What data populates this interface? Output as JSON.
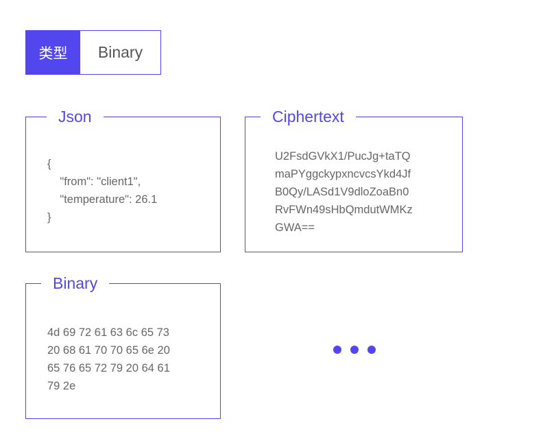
{
  "type_selector": {
    "label": "类型",
    "value": "Binary"
  },
  "panels": {
    "json": {
      "title": "Json",
      "content": "{\n    \"from\": \"client1\",\n    \"temperature\": 26.1\n}"
    },
    "ciphertext": {
      "title": "Ciphertext",
      "content": "U2FsdGVkX1/PucJg+taTQ\nmaPYggckypxncvcsYkd4Jf\nB0Qy/LASd1V9dloZoaBn0\nRvFWn49sHbQmdutWMKz\nGWA=="
    },
    "binary": {
      "title": "Binary",
      "content": "4d 69 72 61 63 6c 65 73\n20 68 61 70 70 65 6e 20\n65 76 65 72 79 20 64 61\n79 2e"
    }
  },
  "more": {
    "icon": "ellipsis-icon"
  },
  "colors": {
    "accent": "#5247ee",
    "text": "#666666"
  }
}
